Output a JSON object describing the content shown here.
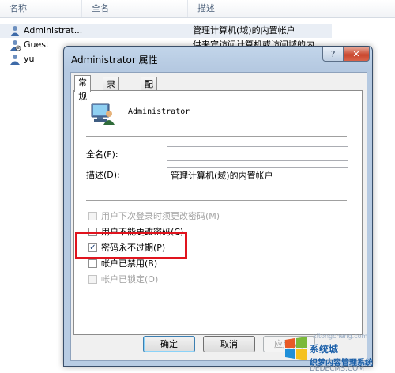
{
  "list": {
    "columns": [
      "名称",
      "全名",
      "描述"
    ],
    "rows": [
      {
        "name": "Administrat...",
        "desc": "管理计算机(域)的内置帐户"
      },
      {
        "name": "Guest",
        "desc": "供来宾访问计算机或访问域的内..."
      },
      {
        "name": "yu",
        "desc": ""
      }
    ]
  },
  "dialog": {
    "title": "Administrator 属性",
    "help_label": "?",
    "close_label": "✕",
    "tabs": [
      "常规",
      "隶属于",
      "配置文件"
    ],
    "account_name": "Administrator",
    "fullname_label": "全名(F):",
    "fullname_value": "",
    "desc_label": "描述(D):",
    "desc_value": "管理计算机(域)的内置帐户",
    "options": [
      {
        "label": "用户下次登录时须更改密码(M)",
        "checked": false,
        "enabled": false
      },
      {
        "label": "用户不能更改密码(C)",
        "checked": false,
        "enabled": true
      },
      {
        "label": "密码永不过期(P)",
        "checked": true,
        "enabled": true
      },
      {
        "label": "帐户已禁用(B)",
        "checked": false,
        "enabled": true
      },
      {
        "label": "帐户已锁定(O)",
        "checked": false,
        "enabled": false
      }
    ],
    "buttons": {
      "ok": "确定",
      "cancel": "取消",
      "apply": "应用(A)"
    }
  },
  "watermark": {
    "line1": "系统城",
    "line2": "织梦内容管理系统",
    "line3": "DEDECMS.COM",
    "site": "xitongcheng.com"
  },
  "colors": {
    "highlight": "#e0141e",
    "title_bar": "#b5c9e1"
  }
}
